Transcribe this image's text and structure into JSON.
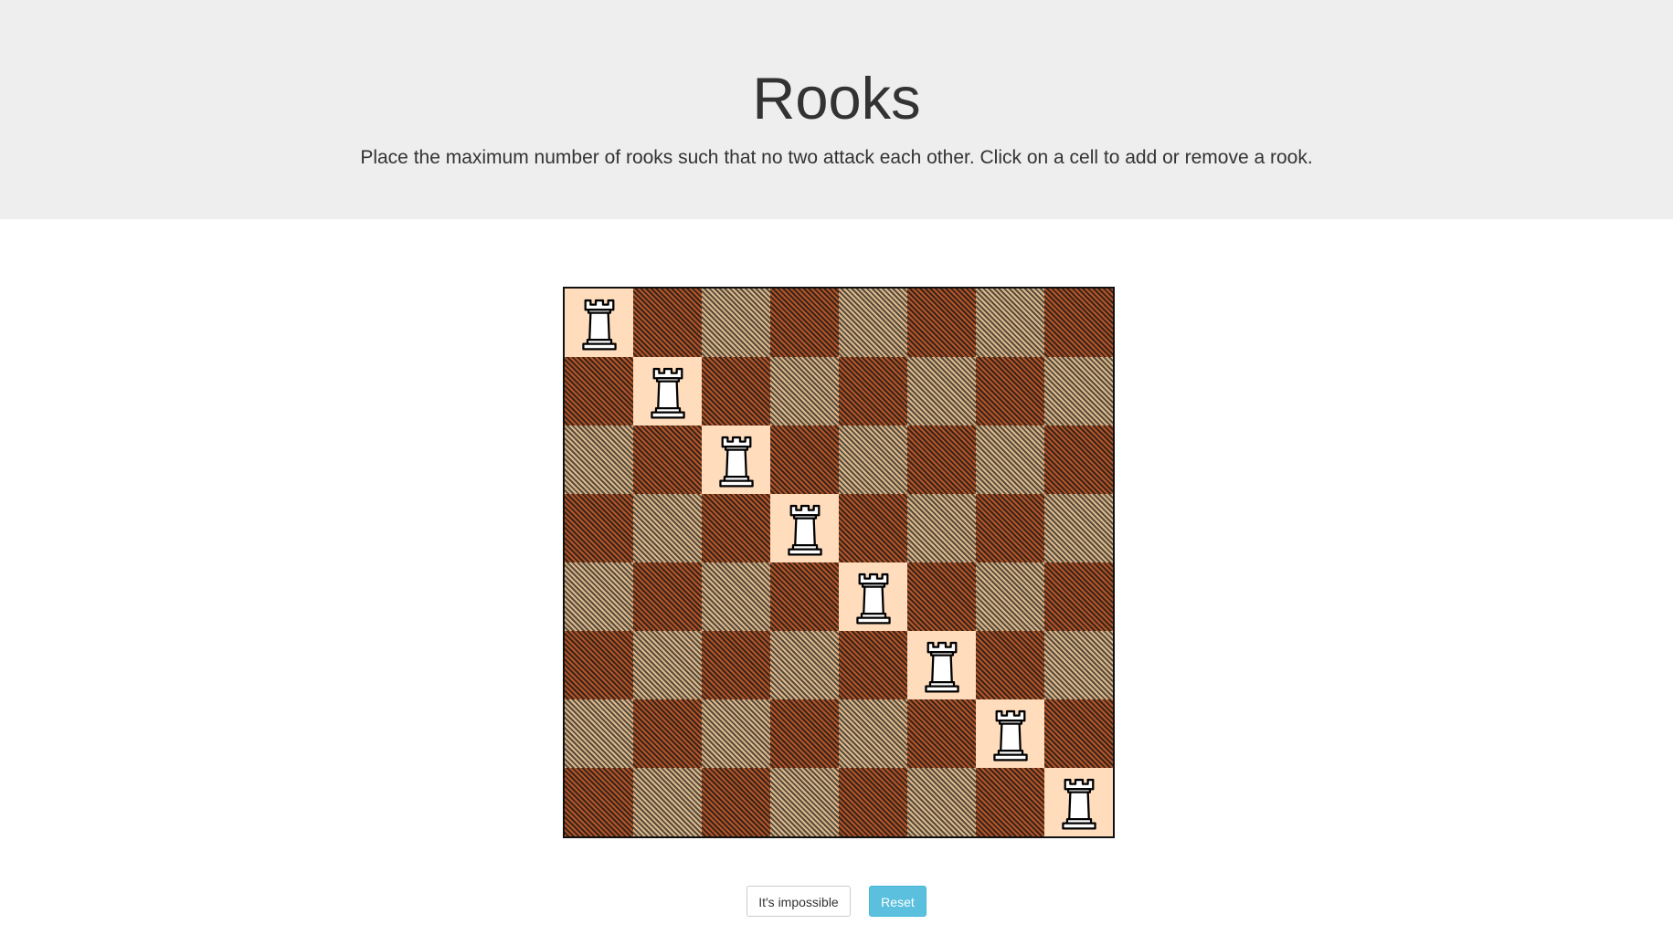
{
  "header": {
    "title": "Rooks",
    "subtitle": "Place the maximum number of rooks such that no two attack each other. Click on a cell to add or remove a rook."
  },
  "board": {
    "size": 8,
    "piece": "rook-icon",
    "rooks": [
      [
        0,
        0
      ],
      [
        1,
        1
      ],
      [
        2,
        2
      ],
      [
        3,
        3
      ],
      [
        4,
        4
      ],
      [
        5,
        5
      ],
      [
        6,
        6
      ],
      [
        7,
        7
      ]
    ],
    "colors": {
      "light": "#d9b98d",
      "dark": "#b4552a",
      "occupied": "#ffdcbc"
    }
  },
  "controls": {
    "impossible_label": "It's impossible",
    "reset_label": "Reset"
  }
}
